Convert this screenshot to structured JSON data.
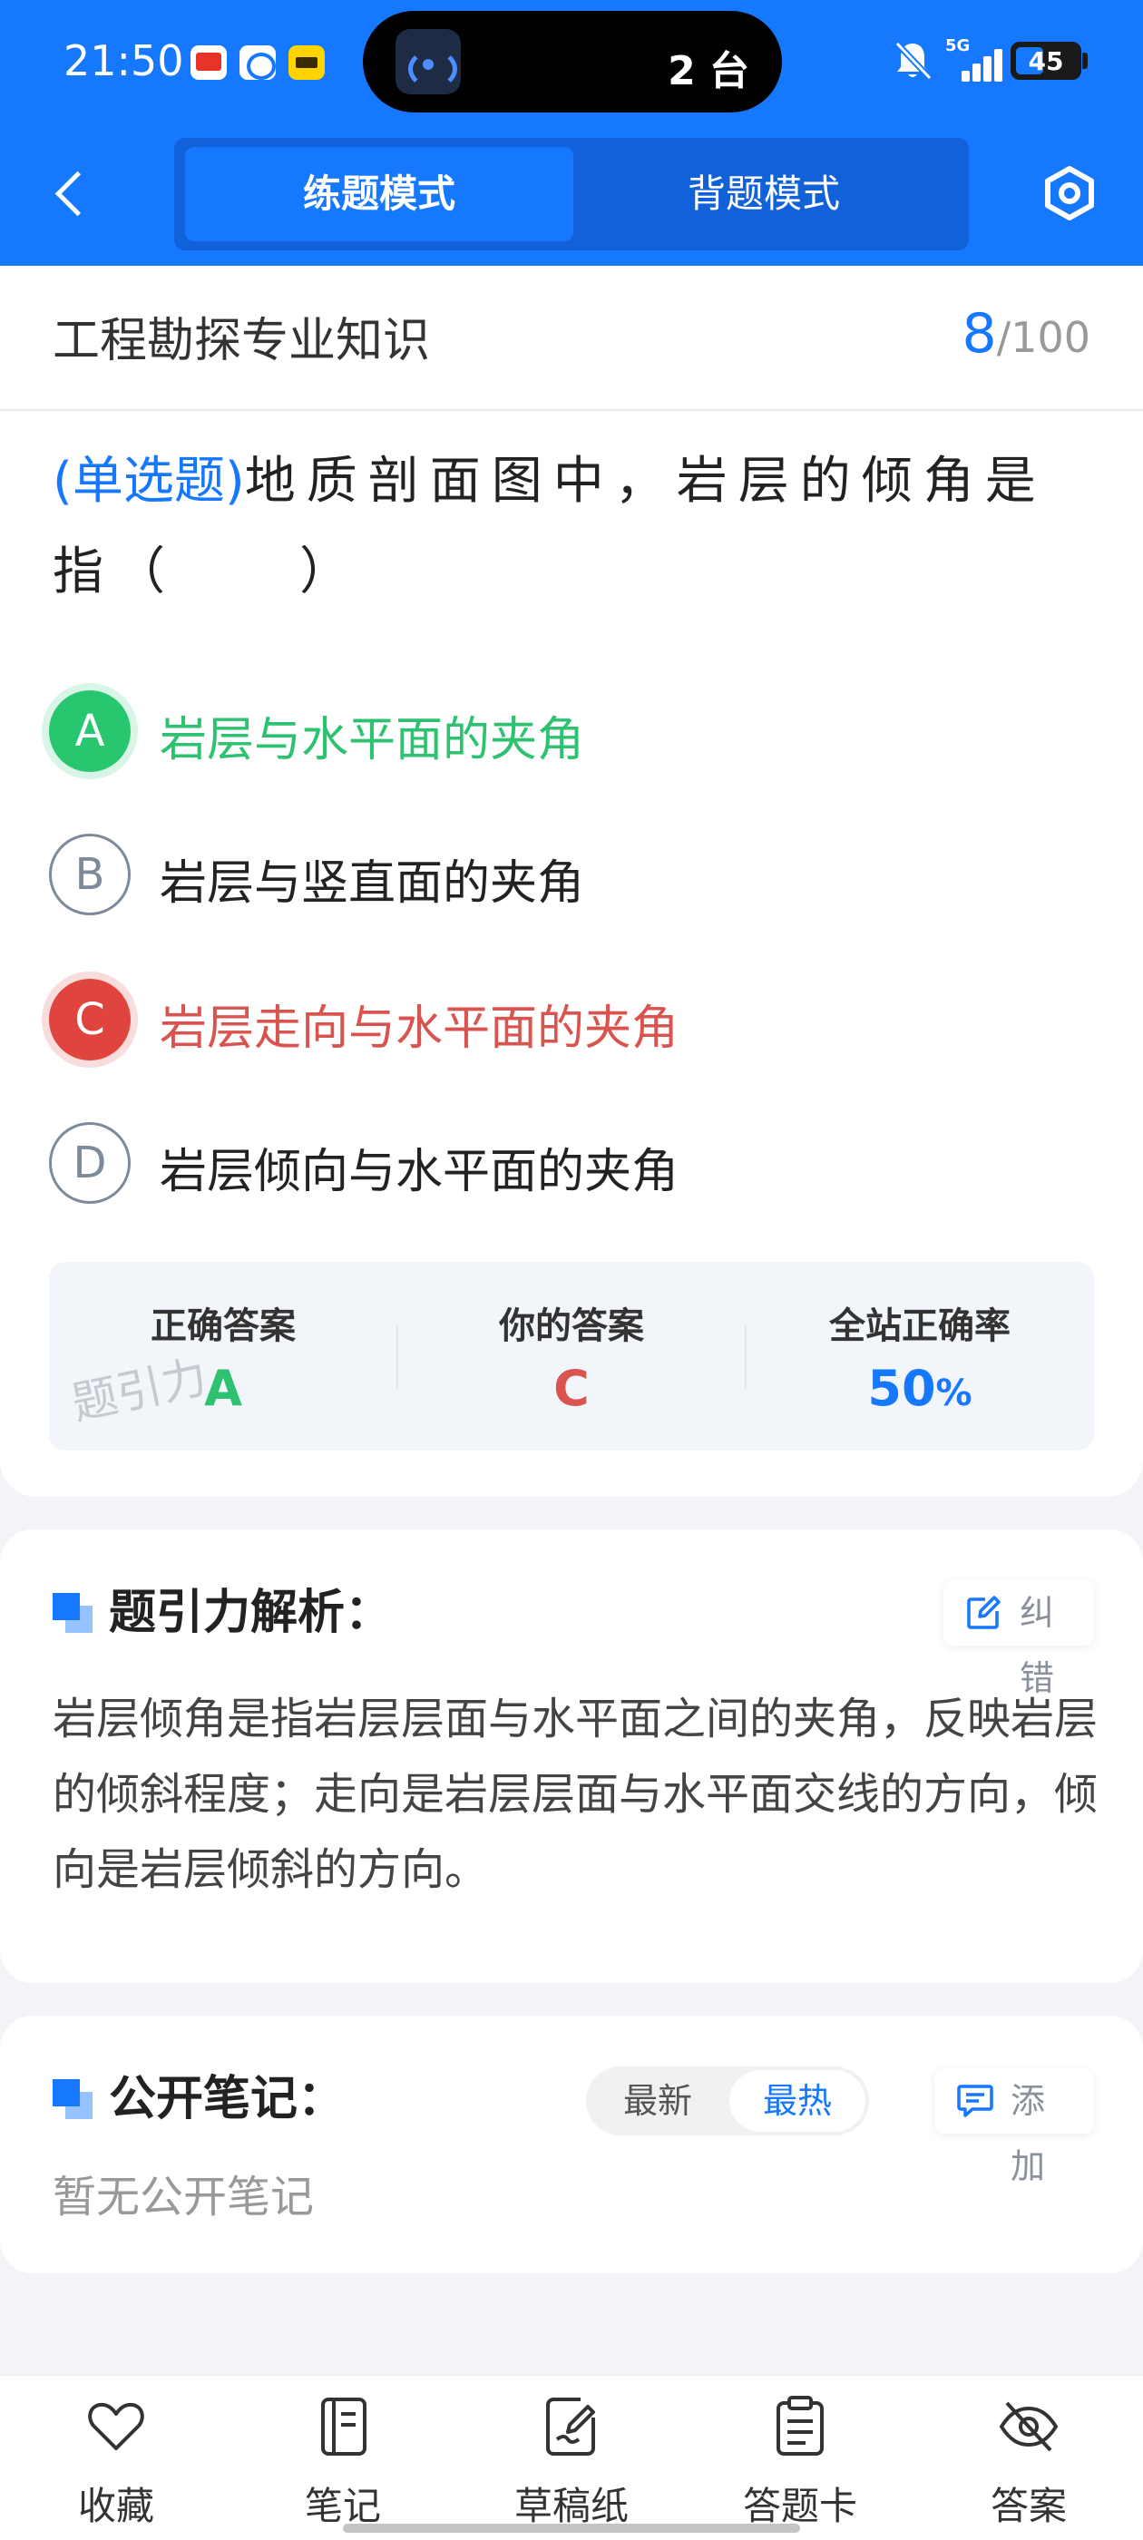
{
  "status_bar": {
    "time": "21:50",
    "island_text": "2 台",
    "battery": "45",
    "battery_level": 0.45,
    "network": "5G"
  },
  "header": {
    "tabs": [
      {
        "label": "练题模式",
        "active": true
      },
      {
        "label": "背题模式",
        "active": false
      }
    ],
    "settings_icon": "settings-hexagon-icon",
    "accent_color": "#1677ff"
  },
  "question": {
    "subject": "工程勘探专业知识",
    "current": "8",
    "total": "100",
    "separator": "/",
    "type": "(单选题)",
    "text": "地质剖面图中，岩层的倾角是指（　　）",
    "options": [
      {
        "letter": "A",
        "text": "岩层与水平面的夹角",
        "state": "correct"
      },
      {
        "letter": "B",
        "text": "岩层与竖直面的夹角",
        "state": "normal"
      },
      {
        "letter": "C",
        "text": "岩层走向与水平面的夹角",
        "state": "wrong"
      },
      {
        "letter": "D",
        "text": "岩层倾向与水平面的夹角",
        "state": "normal"
      }
    ]
  },
  "result": {
    "correct_label": "正确答案",
    "correct_value": "A",
    "yours_label": "你的答案",
    "yours_value": "C",
    "rate_label": "全站正确率",
    "rate_value": "50",
    "rate_unit": "%",
    "watermark": "题引力",
    "colors": {
      "correct": "#2dc26f",
      "wrong": "#d9534f",
      "rate": "#1677ff"
    }
  },
  "analysis": {
    "title": "题引力解析：",
    "correction_label": "纠错",
    "body": "岩层倾角是指岩层层面与水平面之间的夹角，反映岩层的倾斜程度；走向是岩层层面与水平面交线的方向，倾向是岩层倾斜的方向。"
  },
  "notes": {
    "title": "公开笔记：",
    "sort_options": [
      {
        "label": "最新",
        "active": false
      },
      {
        "label": "最热",
        "active": true
      }
    ],
    "add_label": "添加",
    "empty_text": "暂无公开笔记"
  },
  "bottom_nav": [
    {
      "label": "收藏",
      "icon": "heart-icon"
    },
    {
      "label": "笔记",
      "icon": "notebook-icon"
    },
    {
      "label": "草稿纸",
      "icon": "draft-pen-icon"
    },
    {
      "label": "答题卡",
      "icon": "clipboard-icon"
    },
    {
      "label": "答案",
      "icon": "eye-off-icon"
    }
  ]
}
